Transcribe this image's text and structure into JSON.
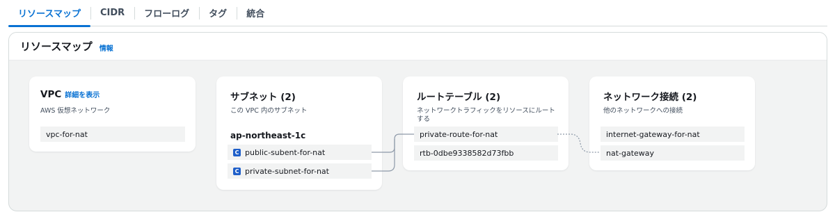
{
  "tabs": [
    {
      "label": "リソースマップ",
      "active": true
    },
    {
      "label": "CIDR"
    },
    {
      "label": "フローログ"
    },
    {
      "label": "タグ"
    },
    {
      "label": "統合"
    }
  ],
  "resource_map": {
    "title": "リソースマップ",
    "info_link": "情報"
  },
  "vpc_card": {
    "title": "VPC",
    "details_link": "詳細を表示",
    "description": "AWS 仮想ネットワーク",
    "vpc_name": "vpc-for-nat"
  },
  "subnets_card": {
    "title": "サブネット (2)",
    "description": "この VPC 内のサブネット",
    "az": "ap-northeast-1c",
    "subnets": [
      {
        "icon": "subnet-icon",
        "name": "public-subent-for-nat"
      },
      {
        "icon": "subnet-icon",
        "name": "private-subnet-for-nat"
      }
    ]
  },
  "route_tables_card": {
    "title": "ルートテーブル (2)",
    "description_line1": "ネットワークトラフィックをリソースにルート",
    "description_line2": "する",
    "tables": [
      "private-route-for-nat",
      "rtb-0dbe9338582d73fbb"
    ]
  },
  "network_connections_card": {
    "title": "ネットワーク接続 (2)",
    "description": "他のネットワークへの接続",
    "connections": [
      "internet-gateway-for-nat",
      "nat-gateway"
    ]
  },
  "colors": {
    "accent": "#0972d3",
    "canvas_bg": "#f2f3f3",
    "subnet_icon": "#1f5fc9",
    "connector": "#8d99a8"
  }
}
